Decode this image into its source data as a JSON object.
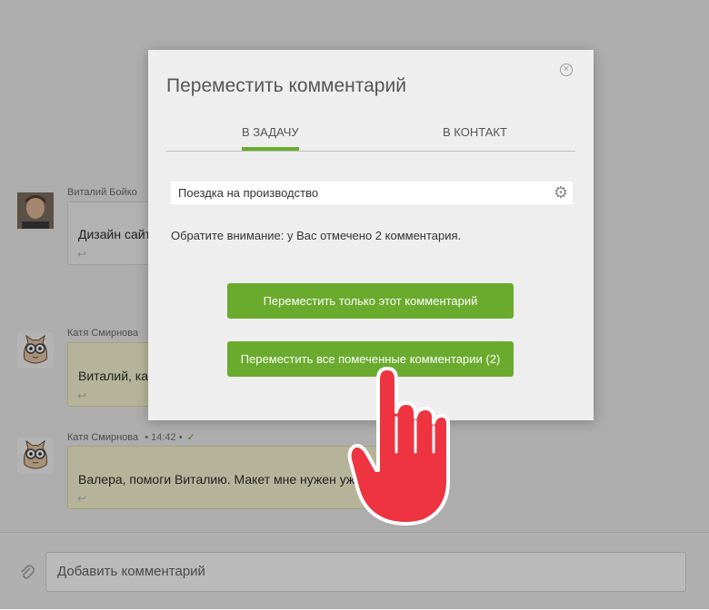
{
  "chat": {
    "messages": [
      {
        "author": "Виталий Бойко",
        "time": "",
        "text": "Дизайн сайт",
        "style": "gray",
        "avatar": "photo"
      },
      {
        "author": "Катя Смирнова",
        "time": "",
        "text": "Виталий, ка",
        "style": "yellow",
        "avatar": "cat"
      },
      {
        "author": "Катя Смирнова",
        "time": "• 14:42 •",
        "text": "Валера, помоги Виталию. Макет мне нужен уже",
        "style": "yellow",
        "avatar": "cat"
      }
    ]
  },
  "comment_bar": {
    "placeholder": "Добавить комментарий",
    "attach_icon": "paperclip-icon"
  },
  "modal": {
    "title": "Переместить комментарий",
    "close_icon": "close-icon",
    "tabs": [
      {
        "label": "В задачу",
        "active": true
      },
      {
        "label": "В контакт",
        "active": false
      }
    ],
    "task_value": "Поездка на производство",
    "settings_icon": "gear-icon",
    "notice": "Обратите внимание: у Вас отмечено 2 комментария.",
    "move_one_label": "Переместить только этот комментарий",
    "move_all_label": "Переместить все помеченные комментарии (2)"
  },
  "colors": {
    "accent": "#6aab2d",
    "hand": "#ee3440"
  }
}
